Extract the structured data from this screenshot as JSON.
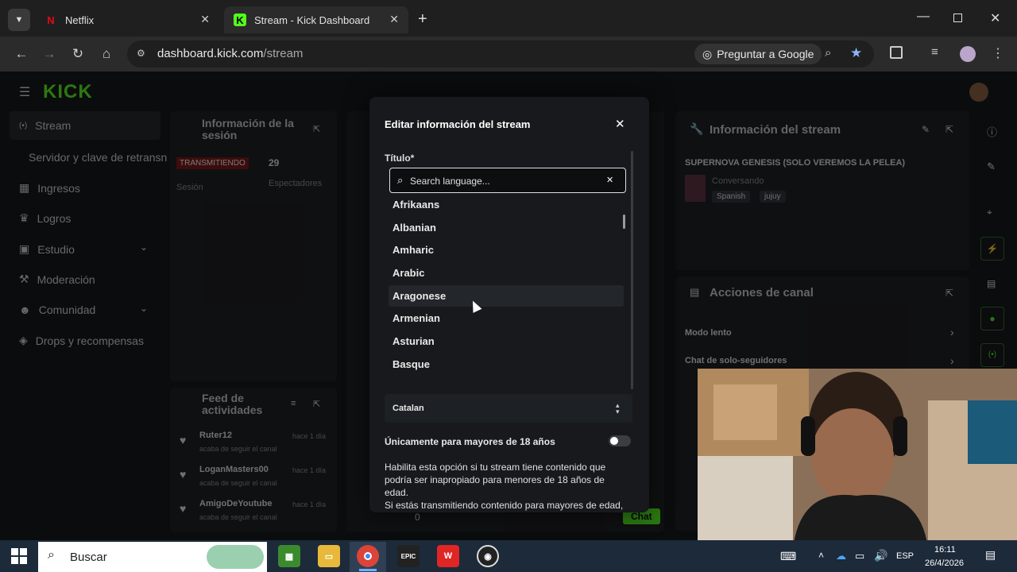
{
  "browser": {
    "tabs": [
      {
        "label": "Netflix",
        "active": false
      },
      {
        "label": "Stream - Kick Dashboard",
        "active": true
      }
    ],
    "url_host": "dashboard.kick.com",
    "url_path": "/stream",
    "ask_google": "Preguntar a Google"
  },
  "sidebar": {
    "logo": "KICK",
    "items": [
      {
        "label": "Stream"
      },
      {
        "label": "Servidor y clave de retransn"
      },
      {
        "label": "Ingresos"
      },
      {
        "label": "Logros"
      },
      {
        "label": "Estudio"
      },
      {
        "label": "Moderación"
      },
      {
        "label": "Comunidad"
      },
      {
        "label": "Drops y recompensas"
      }
    ]
  },
  "session": {
    "title": "Información de la sesión",
    "status": "TRANSMITIENDO",
    "viewers": "29",
    "session_label": "Sesión",
    "viewers_label": "Espectadores"
  },
  "activity": {
    "title": "Feed de actividades",
    "items": [
      {
        "name": "Ruter12",
        "time": "hace 1 día",
        "action": "acaba de seguir el canal"
      },
      {
        "name": "LoganMasters00",
        "time": "hace 1 día",
        "action": "acaba de seguir el canal"
      },
      {
        "name": "AmigoDeYoutube",
        "time": "hace 1 día",
        "action": "acaba de seguir el canal"
      }
    ]
  },
  "stream_info": {
    "title": "Información del stream",
    "stream_title": "SUPERNOVA GENESIS (SOLO VEREMOS LA PELEA)",
    "category": "Conversando",
    "tags": [
      "Spanish",
      "jujuy"
    ]
  },
  "channel_actions": {
    "title": "Acciones de canal",
    "items": [
      "Modo lento",
      "Chat de solo-seguidores"
    ]
  },
  "chat": {
    "count": "0",
    "button": "Chat"
  },
  "modal": {
    "title": "Editar información del stream",
    "field_label": "Título*",
    "search_placeholder": "Search language...",
    "languages": [
      "Afrikaans",
      "Albanian",
      "Amharic",
      "Arabic",
      "Aragonese",
      "Armenian",
      "Asturian",
      "Basque"
    ],
    "selected_language": "Catalan",
    "mature_label": "Únicamente para mayores de 18 años",
    "mature_on": false,
    "mature_desc_1": "Habilita esta opción si tu stream tiene contenido que",
    "mature_desc_2": "podría ser inapropiado para menores de 18 años de edad.",
    "mature_desc_3": "Si estás transmitiendo contenido para mayores de edad,"
  },
  "taskbar": {
    "search": "Buscar",
    "lang": "ESP",
    "time": "16:11",
    "date": "26/4/2026"
  }
}
